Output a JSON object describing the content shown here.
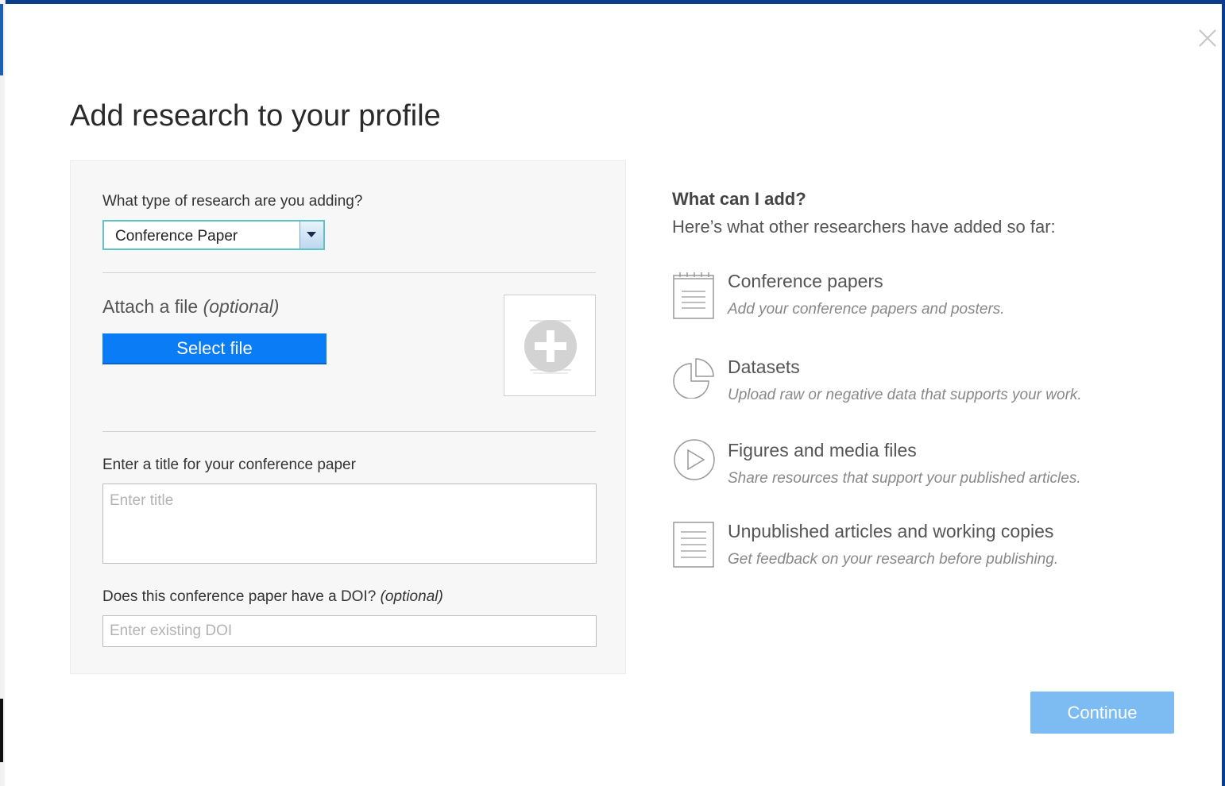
{
  "dialog": {
    "title": "Add research to your profile",
    "close_icon": "close-icon"
  },
  "form": {
    "type_question": "What type of research are you adding?",
    "type_select": {
      "selected": "Conference Paper"
    },
    "attach": {
      "label": "Attach a file",
      "optional": "(optional)",
      "button_label": "Select file",
      "preview_icon": "add-file-icon"
    },
    "title_field": {
      "label": "Enter a title for your conference paper",
      "placeholder": "Enter title",
      "value": ""
    },
    "doi_field": {
      "label": "Does this conference paper have a DOI?",
      "optional": "(optional)",
      "placeholder": "Enter existing DOI",
      "value": ""
    }
  },
  "info": {
    "heading": "What can I add?",
    "subheading": "Here’s what other researchers have added so far:",
    "items": [
      {
        "icon": "notepad-icon",
        "title": "Conference papers",
        "description": "Add your conference papers and posters."
      },
      {
        "icon": "pie-chart-icon",
        "title": "Datasets",
        "description": "Upload raw or negative data that supports your work."
      },
      {
        "icon": "play-icon",
        "title": "Figures and media files",
        "description": "Share resources that support your published articles."
      },
      {
        "icon": "document-icon",
        "title": "Unpublished articles and working copies",
        "description": "Get feedback on your research before publishing."
      }
    ]
  },
  "actions": {
    "continue_label": "Continue"
  },
  "colors": {
    "primary_button": "#0a7cf5",
    "continue_button": "#7cbcf3",
    "select_border": "#5cc4c4",
    "window_accent": "#0b3c8c"
  }
}
